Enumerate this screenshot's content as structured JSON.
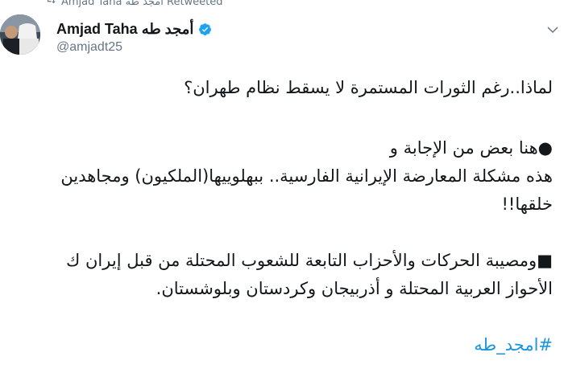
{
  "retweet": {
    "label": "Amjad Taha أمجد طه Retweeted",
    "icon": "retweet-icon"
  },
  "author": {
    "name": "Amjad Taha أمجد طه",
    "handle": "@amjadt25",
    "verified": true,
    "verified_color": "#1da1f2"
  },
  "tweet": {
    "line1": "لماذا..رغم الثورات المستمرة لا يسقط نظام طهران؟",
    "line2": "●هنا بعض من الإجابة و",
    "line3": "هذه مشكلة المعارضة الإيرانية الفارسية.. ببهلوييها(الملكيون) ومجاهدين",
    "line4": "خلقها!!",
    "line5": "■ومصيبة الحركات والأحزاب التابعة للشعوب المحتلة من قبل إيران ك",
    "line6": "الأحواز العربية المحتلة و أذربيجان وكردستان وبلوشستان.",
    "hashtag": "#امجد_طه",
    "hashtag_color": "#1b95e0"
  }
}
